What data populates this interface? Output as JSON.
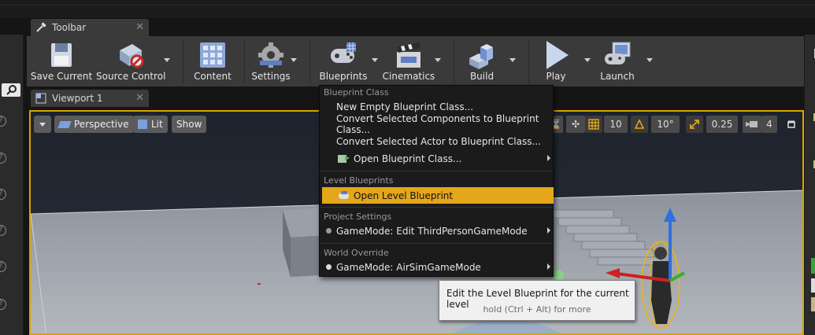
{
  "toolbar_tab": {
    "label": "Toolbar"
  },
  "viewport_tab": {
    "label": "Viewport 1"
  },
  "toolbar": {
    "buttons": [
      {
        "label": "Save Current",
        "icon": "save-icon"
      },
      {
        "label": "Source Control",
        "icon": "source-control-icon"
      },
      {
        "label": "Content",
        "icon": "content-icon"
      },
      {
        "label": "Settings",
        "icon": "settings-icon"
      },
      {
        "label": "Blueprints",
        "icon": "blueprints-icon"
      },
      {
        "label": "Cinematics",
        "icon": "cinematics-icon"
      },
      {
        "label": "Build",
        "icon": "build-icon"
      },
      {
        "label": "Play",
        "icon": "play-icon"
      },
      {
        "label": "Launch",
        "icon": "launch-icon"
      }
    ]
  },
  "viewport": {
    "perspective_label": "Perspective",
    "lit_label": "Lit",
    "show_label": "Show",
    "grid_snap": "10",
    "rotation_snap": "10°",
    "scale_snap": "0.25",
    "camera_speed": "4"
  },
  "menu": {
    "sections": [
      {
        "header": "Blueprint Class",
        "items": [
          "New Empty Blueprint Class...",
          "Convert Selected Components to Blueprint Class...",
          "Convert Selected Actor to Blueprint Class...",
          "Open Blueprint Class..."
        ]
      },
      {
        "header": "Level Blueprints",
        "items": [
          "Open Level Blueprint"
        ]
      },
      {
        "header": "Project Settings",
        "items": [
          "GameMode: Edit ThirdPersonGameMode"
        ]
      },
      {
        "header": "World Override",
        "items": [
          "GameMode: AirSimGameMode"
        ]
      }
    ]
  },
  "tooltip": {
    "title": "Edit the Level Blueprint for the current level",
    "hint": "hold (Ctrl + Alt) for more"
  },
  "colors": {
    "accent": "#e4a61b",
    "selection_border": "#d8a400",
    "panel": "#3a3a3a",
    "menu_bg": "#1b1b1b"
  }
}
